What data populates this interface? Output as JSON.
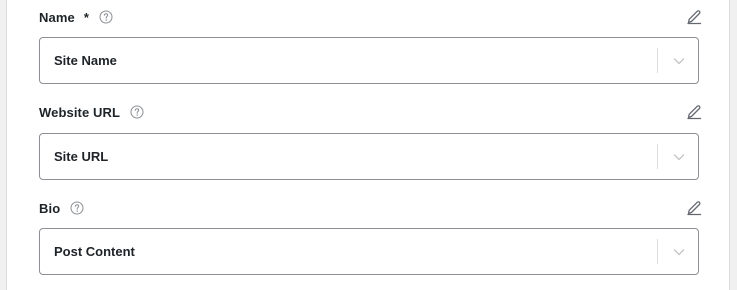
{
  "fields": [
    {
      "label": "Name",
      "required_mark": "*",
      "help_icon": "question-circle-icon",
      "edit_icon": "pencil-icon",
      "value": "Site Name",
      "dropdown_icon": "chevron-down-icon"
    },
    {
      "label": "Website URL",
      "help_icon": "question-circle-icon",
      "edit_icon": "pencil-icon",
      "value": "Site URL",
      "dropdown_icon": "chevron-down-icon"
    },
    {
      "label": "Bio",
      "help_icon": "question-circle-icon",
      "edit_icon": "pencil-icon",
      "value": "Post Content",
      "dropdown_icon": "chevron-down-icon"
    }
  ],
  "colors": {
    "text": "#1d2327",
    "border": "#8c8f94",
    "icon": "#646970",
    "background": "#f0f0f1"
  }
}
